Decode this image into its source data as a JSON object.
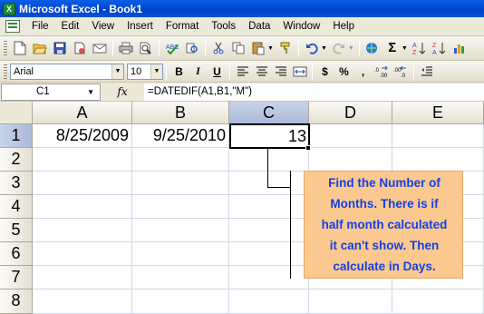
{
  "window": {
    "title": "Microsoft Excel - Book1",
    "app_icon": "X"
  },
  "menu": [
    "File",
    "Edit",
    "View",
    "Insert",
    "Format",
    "Tools",
    "Data",
    "Window",
    "Help"
  ],
  "format_toolbar": {
    "font_name": "Arial",
    "font_size": "10",
    "bold": "B",
    "italic": "I",
    "underline": "U",
    "currency": "$",
    "percent": "%",
    "comma": ","
  },
  "formula_bar": {
    "name_box": "C1",
    "fx": "fx",
    "formula": "=DATEDIF(A1,B1,\"M\")"
  },
  "grid": {
    "columns": [
      "A",
      "B",
      "C",
      "D",
      "E"
    ],
    "rows": [
      "1",
      "2",
      "3",
      "4",
      "5",
      "6",
      "7",
      "8"
    ],
    "cells": {
      "A1": "8/25/2009",
      "B1": "9/25/2010",
      "C1": "13"
    },
    "active_cell": "C1"
  },
  "callout": {
    "text": "Find the Number of Months. There is if half month calculated it can't show. Then calculate in Days.",
    "lines": [
      "Find the Number of",
      "Months. There is if",
      "half month calculated",
      "it can't show. Then",
      "calculate in Days."
    ],
    "fill_color": "#fbc98f",
    "text_color": "#1540e8"
  }
}
